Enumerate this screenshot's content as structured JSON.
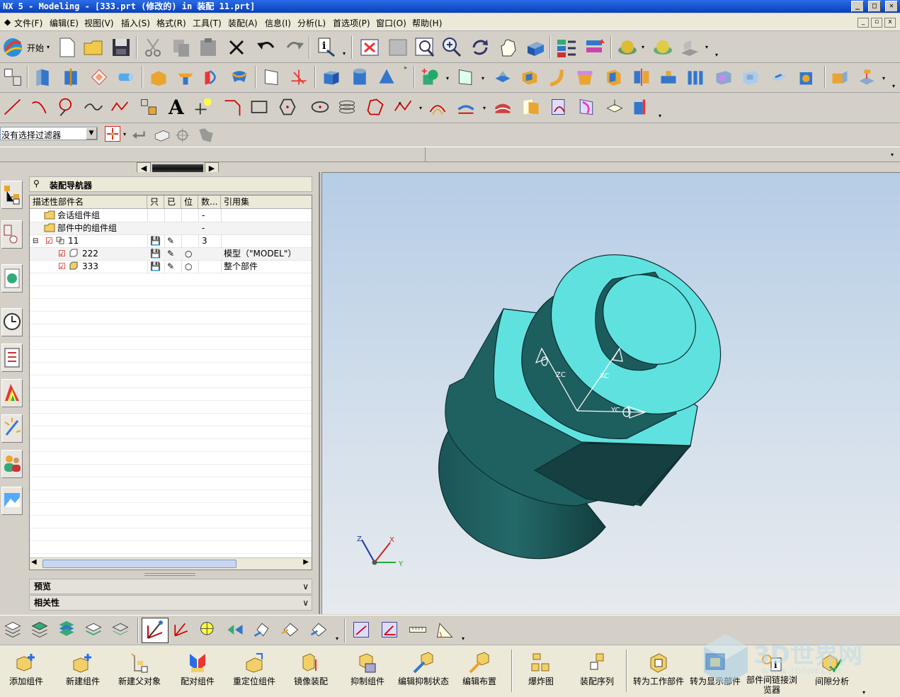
{
  "window": {
    "title": "NX 5 - Modeling - [333.prt  (修改的)   in 装配 11.prt]",
    "min": "_",
    "max": "□",
    "close": "✕"
  },
  "menu": [
    "文件(F)",
    "编辑(E)",
    "视图(V)",
    "插入(S)",
    "格式(R)",
    "工具(T)",
    "装配(A)",
    "信息(I)",
    "分析(L)",
    "首选项(P)",
    "窗口(O)",
    "帮助(H)"
  ],
  "toolbar": {
    "start_label": "开始"
  },
  "filter": {
    "value": "没有选择过滤器"
  },
  "navigator": {
    "title": "装配导航器",
    "columns": [
      "描述性部件名",
      "只",
      "已",
      "位",
      "数...",
      "引用集"
    ],
    "rows": [
      {
        "name": "会话组件组",
        "count": "-",
        "refset": ""
      },
      {
        "name": "部件中的组件组",
        "count": "-",
        "refset": ""
      },
      {
        "name": "11",
        "count": "3",
        "refset": ""
      },
      {
        "name": "222",
        "count": "",
        "refset": "模型（\"MODEL\"）"
      },
      {
        "name": "333",
        "count": "",
        "refset": "整个部件"
      }
    ],
    "preview_label": "预览",
    "relevance_label": "相关性"
  },
  "triad": {
    "z": "ZC",
    "y": "YC",
    "x": "XC"
  },
  "view_triad": {
    "z": "Z",
    "x": "X",
    "y": "Y"
  },
  "assembly_buttons": [
    "添加组件",
    "新建组件",
    "新建父对象",
    "配对组件",
    "重定位组件",
    "镜像装配",
    "抑制组件",
    "编辑抑制状态",
    "编辑布置",
    "爆炸图",
    "装配序列",
    "转为工作部件",
    "转为显示部件",
    "部件间链接浏览器",
    "间隙分析"
  ],
  "watermark": {
    "text": "3D世界网",
    "sub": "WWW.3DSJW.COM"
  },
  "colors": {
    "face": "#5ee3e0",
    "body": "#1d5f60",
    "dark": "#143f40"
  }
}
